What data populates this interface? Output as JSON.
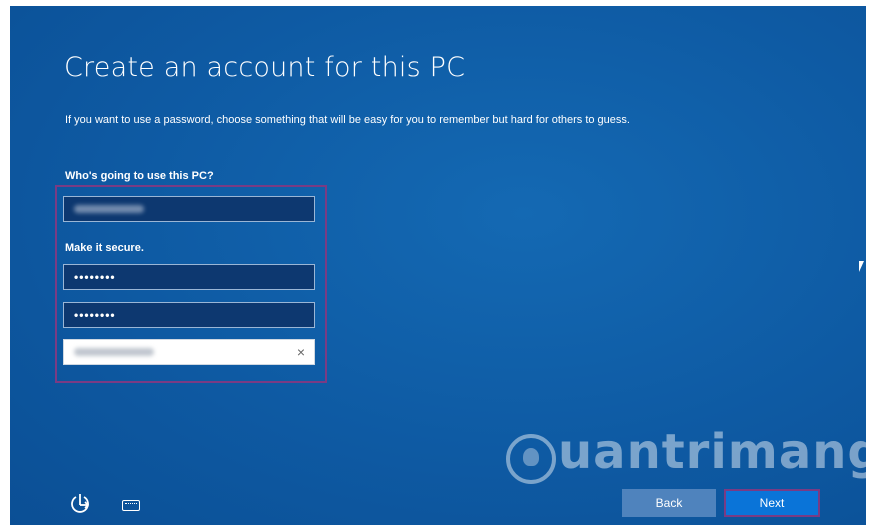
{
  "header": {
    "title": "Create an account for this PC",
    "description": "If you want to use a password, choose something that will be easy for you to remember but hard for others to guess."
  },
  "form": {
    "user_label": "Who's going to use this PC?",
    "secure_label": "Make it secure.",
    "password_mask": "••••••••",
    "reenter_mask": "••••••••",
    "hint_clear": "×"
  },
  "footer": {
    "back_label": "Back",
    "next_label": "Next",
    "ease_icon": "ease-of-access-icon",
    "keyboard_icon": "keyboard-icon"
  },
  "watermark": {
    "text": "uantrimang"
  },
  "colors": {
    "background": "#0e5aa3",
    "field_dark": "#0d3870",
    "highlight": "#7a3b84",
    "next_button": "#0a74d8",
    "back_button": "#4f83bd"
  }
}
